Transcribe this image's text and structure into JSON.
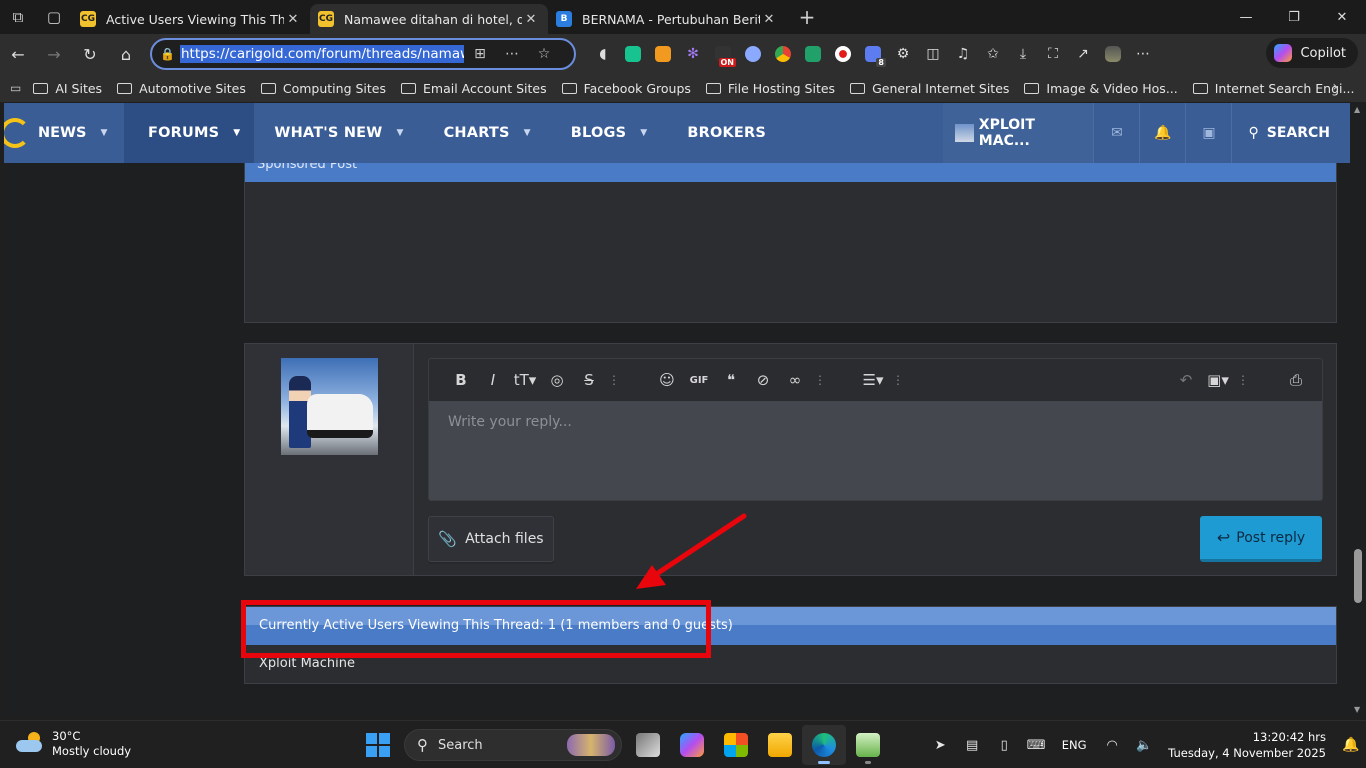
{
  "browser": {
    "tabs": [
      {
        "title": "Active Users Viewing This Thread",
        "favicon": "CG",
        "active": false
      },
      {
        "title": "Namawee ditahan di hotel, didapati",
        "favicon": "CG",
        "active": true
      },
      {
        "title": "BERNAMA - Pertubuhan Berita Nasional",
        "favicon": "B",
        "active": false
      }
    ],
    "url": "https://carigold.com/forum/threads/namawee",
    "copilot_label": "Copilot",
    "extension_badge_on": "ON",
    "extension_badge_count": "8"
  },
  "bookmarks": [
    "AI Sites",
    "Automotive Sites",
    "Computing Sites",
    "Email Account Sites",
    "Facebook Groups",
    "File Hosting Sites",
    "General Internet Sites",
    "Image & Video Hos...",
    "Internet Search Engi..."
  ],
  "site": {
    "nav": {
      "news": "NEWS",
      "forums": "FORUMS",
      "whats_new": "WHAT'S NEW",
      "charts": "CHARTS",
      "blogs": "BLOGS",
      "brokers": "BROKERS"
    },
    "user": "XPLOIT MAC...",
    "search": "SEARCH"
  },
  "sponsored": {
    "label": "Sponsored Post"
  },
  "reply": {
    "placeholder": "Write your reply...",
    "attach_label": "Attach files",
    "post_label": "Post reply"
  },
  "active_users": {
    "header": "Currently Active Users Viewing This Thread: 1 (1 members and 0 guests)",
    "members": [
      "Xploit Machine"
    ]
  },
  "annotation_color": "#e8050b",
  "taskbar": {
    "temp": "30°C",
    "condition": "Mostly cloudy",
    "search_label": "Search",
    "lang": "ENG",
    "time": "13:20:42 hrs",
    "date": "Tuesday, 4 November 2025"
  }
}
